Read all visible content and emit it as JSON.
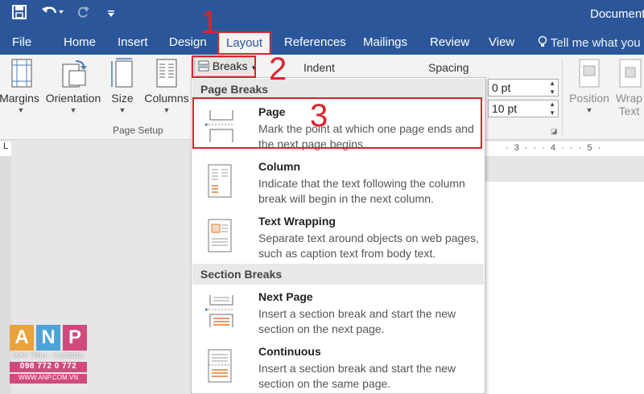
{
  "app": {
    "doc_title": "Document",
    "qat": {
      "save_icon": "save-icon",
      "undo_icon": "undo-icon",
      "redo_icon": "redo-icon",
      "customize_icon": "customize-qat-icon"
    }
  },
  "tabs": [
    "File",
    "Home",
    "Insert",
    "Design",
    "Layout",
    "References",
    "Mailings",
    "Review",
    "View"
  ],
  "active_tab": "Layout",
  "tell_me": "Tell me what you",
  "ribbon": {
    "margins": "Margins",
    "orientation": "Orientation",
    "size": "Size",
    "columns": "Columns",
    "page_setup_group": "Page Setup",
    "breaks": "Breaks",
    "indent": "Indent",
    "spacing": "Spacing",
    "spacing_before": "0 pt",
    "spacing_after": "10 pt",
    "position": "Position",
    "wrap_text_line1": "Wrap",
    "wrap_text_line2": "Text"
  },
  "breaks_menu": {
    "page_breaks_header": "Page Breaks",
    "section_breaks_header": "Section Breaks",
    "items": [
      {
        "title": "Page",
        "desc": "Mark the point at which one page ends and the next page begins."
      },
      {
        "title": "Column",
        "desc": "Indicate that the text following the column break will begin in the next column."
      },
      {
        "title": "Text Wrapping",
        "desc": "Separate text around objects on web pages, such as caption text from body text."
      },
      {
        "title": "Next Page",
        "desc": "Insert a section break and start the new section on the next page."
      },
      {
        "title": "Continuous",
        "desc": "Insert a section break and start the new section on the same page."
      }
    ]
  },
  "ruler": {
    "marks": "· 3 · · · 4 · · · 5 ·",
    "corner": "L"
  },
  "annotations": {
    "step1": "1",
    "step2": "2",
    "step3": "3"
  },
  "watermark": {
    "letters": [
      "A",
      "N",
      "P"
    ],
    "tagline": "MÁY TÍNH - CAMERA",
    "phone": "098 772 0 772",
    "website": "WWW.ANP.COM.VN"
  },
  "colors": {
    "word_blue": "#2b579a",
    "annotation_red": "#d9242b",
    "logo_a": "#e8a33d",
    "logo_n": "#4ea4d9",
    "logo_p": "#d04a7f"
  }
}
